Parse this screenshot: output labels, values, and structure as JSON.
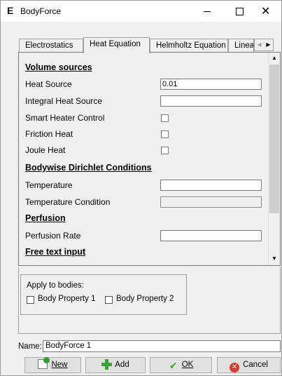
{
  "window": {
    "title": "BodyForce",
    "app_icon": "E",
    "minimize_glyph": "—",
    "maximize_glyph": "☐",
    "close_glyph": "✕"
  },
  "tabs": [
    {
      "label": "Electrostatics",
      "active": false
    },
    {
      "label": "Heat Equation",
      "active": true
    },
    {
      "label": "Helmholtz Equation",
      "active": false
    },
    {
      "label": "Linea",
      "active": false
    }
  ],
  "tab_scroll": {
    "left_glyph": "◀",
    "right_glyph": "▶"
  },
  "form": {
    "volume_sources_title": "Volume sources",
    "heat_source_label": "Heat Source",
    "heat_source_value": "0.01",
    "integral_heat_source_label": "Integral Heat Source",
    "integral_heat_source_value": "",
    "smart_heater_label": "Smart Heater Control",
    "friction_heat_label": "Friction Heat",
    "joule_heat_label": "Joule Heat",
    "dirichlet_title": "Bodywise Dirichlet Conditions",
    "temperature_label": "Temperature",
    "temperature_value": "",
    "temperature_condition_label": "Temperature Condition",
    "temperature_condition_value": "",
    "perfusion_title": "Perfusion",
    "perfusion_rate_label": "Perfusion Rate",
    "perfusion_rate_value": "",
    "free_text_title": "Free text input"
  },
  "scrollbar": {
    "up_glyph": "▲",
    "down_glyph": "▼"
  },
  "apply": {
    "title": "Apply to bodies:",
    "bodies": [
      "Body Property 1",
      "Body Property 2"
    ]
  },
  "name": {
    "label": "Name:",
    "value": "BodyForce 1"
  },
  "buttons": {
    "new": "New",
    "add": "Add",
    "ok": "OK",
    "cancel": "Cancel",
    "ok_glyph": "✔",
    "cancel_glyph": "✕"
  }
}
